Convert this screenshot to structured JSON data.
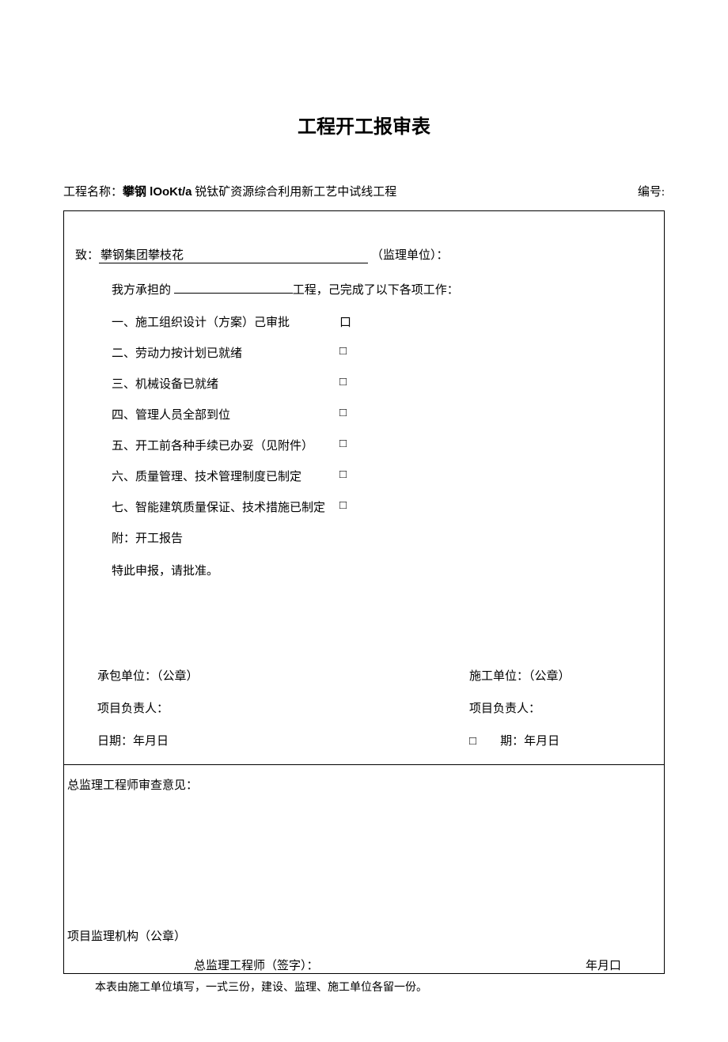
{
  "title": "工程开工报审表",
  "header": {
    "name_label": "工程名称：",
    "name_bold_part": "攀钢 lOoKt/a",
    "name_rest": " 锐钛矿资源综合利用新工艺中试线工程",
    "number_label": "编号:"
  },
  "addressee": {
    "to_label": "致：",
    "to_value": "攀钢集团攀枝花",
    "to_suffix": "（监理单位）："
  },
  "intro": {
    "prefix": "我方承担的 ",
    "suffix": "工程，己完成了以下各项工作："
  },
  "items": [
    {
      "text": "一、施工组织设计（方案）己审批",
      "mark": "口"
    },
    {
      "text": "二、劳动力按计划已就绪",
      "mark": "□"
    },
    {
      "text": "三、机械设备已就绪",
      "mark": "□"
    },
    {
      "text": "四、管理人员全部到位",
      "mark": "□"
    },
    {
      "text": "五、开工前各种手续已办妥（见附件）",
      "mark": "□"
    },
    {
      "text": "六、质量管理、技术管理制度已制定",
      "mark": "□"
    },
    {
      "text": "七、智能建筑质量保证、技术措施已制定",
      "mark": "□"
    }
  ],
  "attach": "附：开工报告",
  "apply": "特此申报，请批准。",
  "sig": {
    "left_unit": "承包单位：（公章）",
    "right_unit": "施工单位：（公章）",
    "left_person": "项目负责人：",
    "right_person": "项目负责人：",
    "left_date": "日期：年月日",
    "right_mark": "□",
    "right_date": "期：年月日"
  },
  "lower": {
    "review_label": "总监理工程师审查意见：",
    "org_label": "项目监理机构（公章）",
    "signer_label": "总监理工程师（签字）：",
    "date_label": "年月口"
  },
  "note": "本表由施工单位填写，一式三份，建设、监理、施工单位各留一份。"
}
